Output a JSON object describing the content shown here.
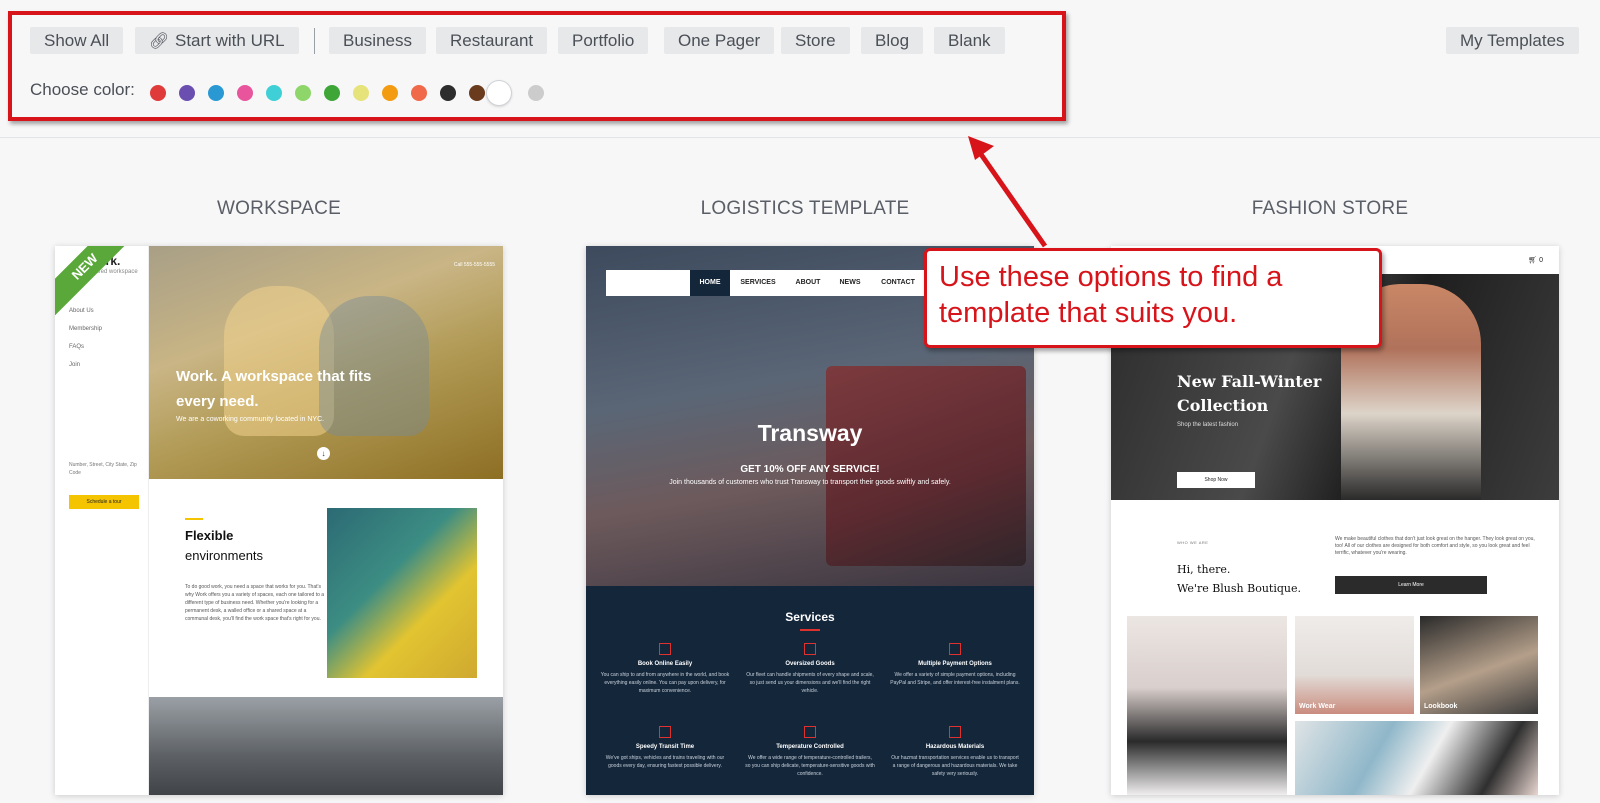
{
  "filters": {
    "show_all": "Show All",
    "start_with_url": "Start with URL",
    "categories": [
      "Business",
      "Restaurant",
      "Portfolio",
      "One Pager",
      "Store",
      "Blog",
      "Blank"
    ],
    "my_templates": "My Templates"
  },
  "colors": {
    "label": "Choose color:",
    "swatches": [
      "#e03b3b",
      "#6a4fb0",
      "#2a98d2",
      "#e8559c",
      "#3fcfd6",
      "#8fd66a",
      "#3da637",
      "#e6e37a",
      "#f39c12",
      "#f0694a",
      "#2d2d2d",
      "#6b3b1d",
      "#ffffff",
      "#cccccc"
    ],
    "selected_index": 12
  },
  "templates": [
    {
      "title": "WORKSPACE",
      "badge": "NEW",
      "logo": "work.",
      "tagline": "shared workspace",
      "nav": [
        "About Us",
        "Membership",
        "FAQs",
        "Join"
      ],
      "phone": "Call 555-555-5555",
      "hero_title": "Work. A workspace that fits every need.",
      "hero_sub": "We are a coworking community located in NYC.",
      "address": "Number, Street, City State, Zip Code",
      "cta": "Schedule a tour",
      "section_title_1": "Flexible",
      "section_title_2": "environments",
      "section_body": "To do good work, you need a space that works for you. That's why Work offers you a variety of spaces, each one tailored to a different type of business need. Whether you're looking for a permanent desk, a walled office or a shared space at a communal desk, you'll find the work space that's right for you."
    },
    {
      "title": "LOGISTICS TEMPLATE",
      "nav": [
        "HOME",
        "SERVICES",
        "ABOUT",
        "NEWS",
        "CONTACT"
      ],
      "brand": "Transway",
      "promo": "GET 10% OFF ANY SERVICE!",
      "promo_sub": "Join thousands of customers who trust Transway to transport their goods swiftly and safely.",
      "services_title": "Services",
      "services": [
        {
          "name": "Book Online Easily",
          "body": "You can ship to and from anywhere in the world, and book everything easily online. You can pay upon delivery, for maximum convenience."
        },
        {
          "name": "Oversized Goods",
          "body": "Our fleet can handle shipments of every shape and scale, so just send us your dimensions and we'll find the right vehicle."
        },
        {
          "name": "Multiple Payment Options",
          "body": "We offer a variety of simple payment options, including PayPal and Stripe, and offer interest-free instalment plans."
        },
        {
          "name": "Speedy Transit Time",
          "body": "We've got ships, vehicles and trains traveling with our goods every day, ensuring fastest possible delivery."
        },
        {
          "name": "Temperature Controlled",
          "body": "We offer a wide range of temperature-controlled trailers, so you can ship delicate, temperature-sensitive goods with confidence."
        },
        {
          "name": "Hazardous Materials",
          "body": "Our hazmat transportation services enable us to transport a range of dangerous and hazardous materials. We take safety very seriously."
        }
      ]
    },
    {
      "title": "FASHION STORE",
      "cart": "0",
      "hero_title": "New Fall-Winter Collection",
      "hero_sub": "Shop the latest fashion",
      "hero_button": "Shop Now",
      "who": "WHO WE ARE",
      "greeting_1": "Hi, there.",
      "greeting_2": "We're Blush Boutique.",
      "body": "We make beautiful clothes that don't just look great on the hanger. They look great on you, too! All of our clothes are designed for both comfort and style, so you look great and feel terrific, whatever you're wearing.",
      "learn_more": "Learn More",
      "tiles": [
        "",
        "Work Wear",
        "Lookbook"
      ]
    }
  ],
  "callout": {
    "text": "Use these options to find a template that suits you.",
    "color": "#d7141a"
  }
}
